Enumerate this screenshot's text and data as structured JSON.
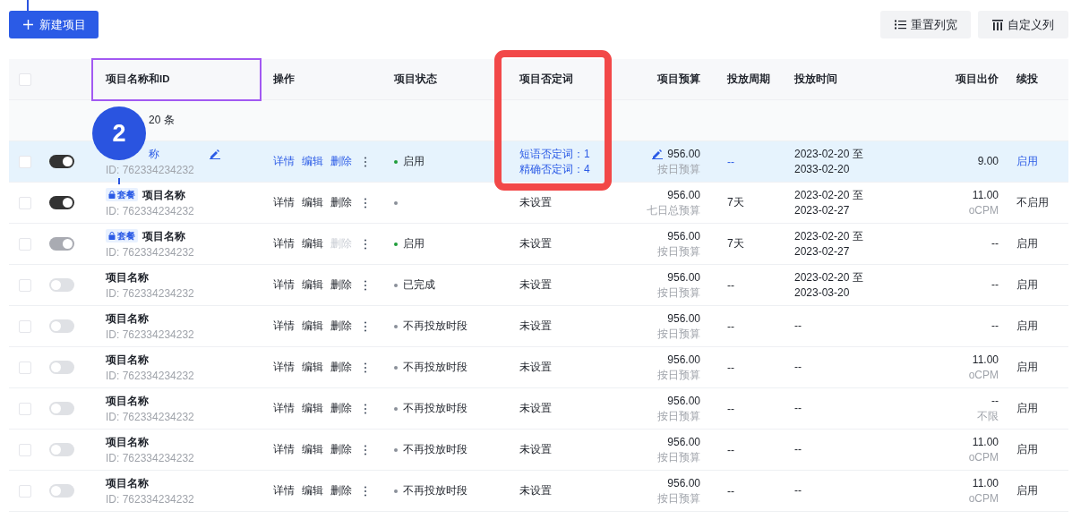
{
  "toolbar": {
    "new_button": {
      "label": "新建项目"
    },
    "buttons": [
      {
        "kind": "reset",
        "label": "重置列宽"
      },
      {
        "kind": "columns",
        "label": "自定义列"
      }
    ]
  },
  "table": {
    "header_checked": false,
    "columns": [
      "项目名称和ID",
      "操作",
      "项目状态",
      "项目否定词",
      "项目预算",
      "投放周期",
      "投放时间",
      "项目出价",
      "续投"
    ],
    "summary": "20 条",
    "rows": [
      {
        "selected": true,
        "checked": false,
        "toggle_on": true,
        "toggle_disabled": false,
        "tag": null,
        "name": "称",
        "id": "ID: 762334234232",
        "editable": true,
        "actions": [
          {
            "label": "详情",
            "disabled": false
          },
          {
            "label": "编辑",
            "disabled": false
          },
          {
            "label": "删除",
            "disabled": false
          }
        ],
        "status": {
          "label": "启用",
          "color": "#1f9d3a"
        },
        "negatives": [
          "短语否定词：1",
          "精确否定词：4"
        ],
        "budget": "956.00",
        "budget_type": "按日预算",
        "period": "--",
        "time": [
          "2023-02-20 至",
          "2033-02-20"
        ],
        "price": "9.00",
        "price_type": null,
        "renew": "启用"
      },
      {
        "selected": false,
        "checked": false,
        "toggle_on": true,
        "toggle_disabled": false,
        "tag": "套餐",
        "name": "项目名称",
        "id": "ID: 762334234232",
        "editable": false,
        "actions": [
          {
            "label": "详情",
            "disabled": false
          },
          {
            "label": "编辑",
            "disabled": false
          },
          {
            "label": "删除",
            "disabled": false
          }
        ],
        "status": {
          "color": "#8a8f99"
        },
        "negatives": [
          "未设置"
        ],
        "budget": "956.00",
        "budget_type": "七日总预算",
        "period": "7天",
        "time": [
          "2023-02-20 至",
          "2023-02-27"
        ],
        "price": "11.00",
        "price_type": "oCPM",
        "renew": "不启用"
      },
      {
        "selected": false,
        "checked": false,
        "toggle_on": true,
        "toggle_disabled": true,
        "tag": "套餐",
        "name": "项目名称",
        "id": "ID: 762334234232",
        "editable": false,
        "actions": [
          {
            "label": "详情",
            "disabled": false
          },
          {
            "label": "编辑",
            "disabled": false
          },
          {
            "label": "删除",
            "disabled": true
          }
        ],
        "status": {
          "label": "启用",
          "color": "#1f9d3a"
        },
        "negatives": [
          "未设置"
        ],
        "budget": "956.00",
        "budget_type": "按日预算",
        "period": "7天",
        "time": [
          "2023-02-20 至",
          "2023-02-27"
        ],
        "price": "--",
        "price_type": null,
        "renew": "启用"
      },
      {
        "selected": false,
        "checked": false,
        "toggle_on": false,
        "toggle_disabled": false,
        "tag": null,
        "name": "项目名称",
        "id": "ID: 762334234232",
        "editable": false,
        "actions": [
          {
            "label": "详情",
            "disabled": false
          },
          {
            "label": "编辑",
            "disabled": false
          },
          {
            "label": "删除",
            "disabled": false
          }
        ],
        "status": {
          "label": "已完成",
          "color": "#8a8f99"
        },
        "negatives": [
          "未设置"
        ],
        "budget": "956.00",
        "budget_type": "按日预算",
        "period": "--",
        "time": [
          "2023-02-20 至",
          "2023-03-20"
        ],
        "price": "--",
        "price_type": null,
        "renew": "启用"
      },
      {
        "selected": false,
        "checked": false,
        "toggle_on": false,
        "toggle_disabled": false,
        "tag": null,
        "name": "项目名称",
        "id": "ID: 762334234232",
        "editable": false,
        "actions": [
          {
            "label": "详情",
            "disabled": false
          },
          {
            "label": "编辑",
            "disabled": false
          },
          {
            "label": "删除",
            "disabled": false
          }
        ],
        "status": {
          "label": "不再投放时段",
          "color": "#8a8f99"
        },
        "negatives": [
          "未设置"
        ],
        "budget": "956.00",
        "budget_type": "按日预算",
        "period": "--",
        "time": [
          "--"
        ],
        "price": "--",
        "price_type": null,
        "renew": "启用"
      },
      {
        "selected": false,
        "checked": false,
        "toggle_on": false,
        "toggle_disabled": false,
        "tag": null,
        "name": "项目名称",
        "id": "ID: 762334234232",
        "editable": false,
        "actions": [
          {
            "label": "详情",
            "disabled": false
          },
          {
            "label": "编辑",
            "disabled": false
          },
          {
            "label": "删除",
            "disabled": false
          }
        ],
        "status": {
          "label": "不再投放时段",
          "color": "#8a8f99"
        },
        "negatives": [
          "未设置"
        ],
        "budget": "956.00",
        "budget_type": "按日预算",
        "period": "--",
        "time": [
          "--"
        ],
        "price": "11.00",
        "price_type": "oCPM",
        "renew": "启用"
      },
      {
        "selected": false,
        "checked": false,
        "toggle_on": false,
        "toggle_disabled": false,
        "tag": null,
        "name": "项目名称",
        "id": "ID: 762334234232",
        "editable": false,
        "actions": [
          {
            "label": "详情",
            "disabled": false
          },
          {
            "label": "编辑",
            "disabled": false
          },
          {
            "label": "删除",
            "disabled": false
          }
        ],
        "status": {
          "label": "不再投放时段",
          "color": "#8a8f99"
        },
        "negatives": [
          "未设置"
        ],
        "budget": "956.00",
        "budget_type": "按日预算",
        "period": "--",
        "time": [
          "--"
        ],
        "price": "--",
        "price_type": "不限",
        "renew": "启用"
      },
      {
        "selected": false,
        "checked": false,
        "toggle_on": false,
        "toggle_disabled": false,
        "tag": null,
        "name": "项目名称",
        "id": "ID: 762334234232",
        "editable": false,
        "actions": [
          {
            "label": "详情",
            "disabled": false
          },
          {
            "label": "编辑",
            "disabled": false
          },
          {
            "label": "删除",
            "disabled": false
          }
        ],
        "status": {
          "label": "不再投放时段",
          "color": "#8a8f99"
        },
        "negatives": [
          "未设置"
        ],
        "budget": "956.00",
        "budget_type": "按日预算",
        "period": "--",
        "time": [
          "--"
        ],
        "price": "11.00",
        "price_type": "oCPM",
        "renew": "启用"
      },
      {
        "selected": false,
        "checked": false,
        "toggle_on": false,
        "toggle_disabled": false,
        "tag": null,
        "name": "项目名称",
        "id": "ID: 762334234232",
        "editable": false,
        "actions": [
          {
            "label": "详情",
            "disabled": false
          },
          {
            "label": "编辑",
            "disabled": false
          },
          {
            "label": "删除",
            "disabled": false
          }
        ],
        "status": {
          "label": "不再投放时段",
          "color": "#8a8f99"
        },
        "negatives": [
          "未设置"
        ],
        "budget": "956.00",
        "budget_type": "按日预算",
        "period": "--",
        "time": [
          "--"
        ],
        "price": "11.00",
        "price_type": "oCPM",
        "renew": "启用"
      }
    ]
  },
  "annotations": {
    "highlights": [
      {
        "color": "#a259f2"
      },
      {
        "color": "#f24848"
      }
    ],
    "callout": {
      "label": "2"
    }
  }
}
